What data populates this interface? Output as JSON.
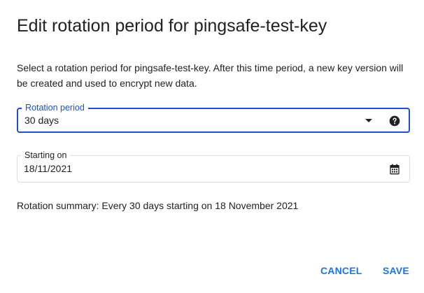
{
  "dialog": {
    "title": "Edit rotation period for pingsafe-test-key",
    "description": "Select a rotation period for pingsafe-test-key. After this time period, a new key version will be created and used to encrypt new data.",
    "rotation_period": {
      "label": "Rotation period",
      "value": "30 days",
      "dropdown_icon": "arrow-drop-down-icon",
      "help_icon": "help-icon"
    },
    "starting_on": {
      "label": "Starting on",
      "value": "18/11/2021",
      "icon": "calendar-icon"
    },
    "summary": "Rotation summary: Every 30 days starting on 18 November 2021",
    "buttons": {
      "cancel": "CANCEL",
      "save": "SAVE"
    }
  },
  "colors": {
    "accent": "#1a73e8",
    "focused_border": "#1a4fd6",
    "text": "#202124",
    "border": "#dadce0"
  }
}
